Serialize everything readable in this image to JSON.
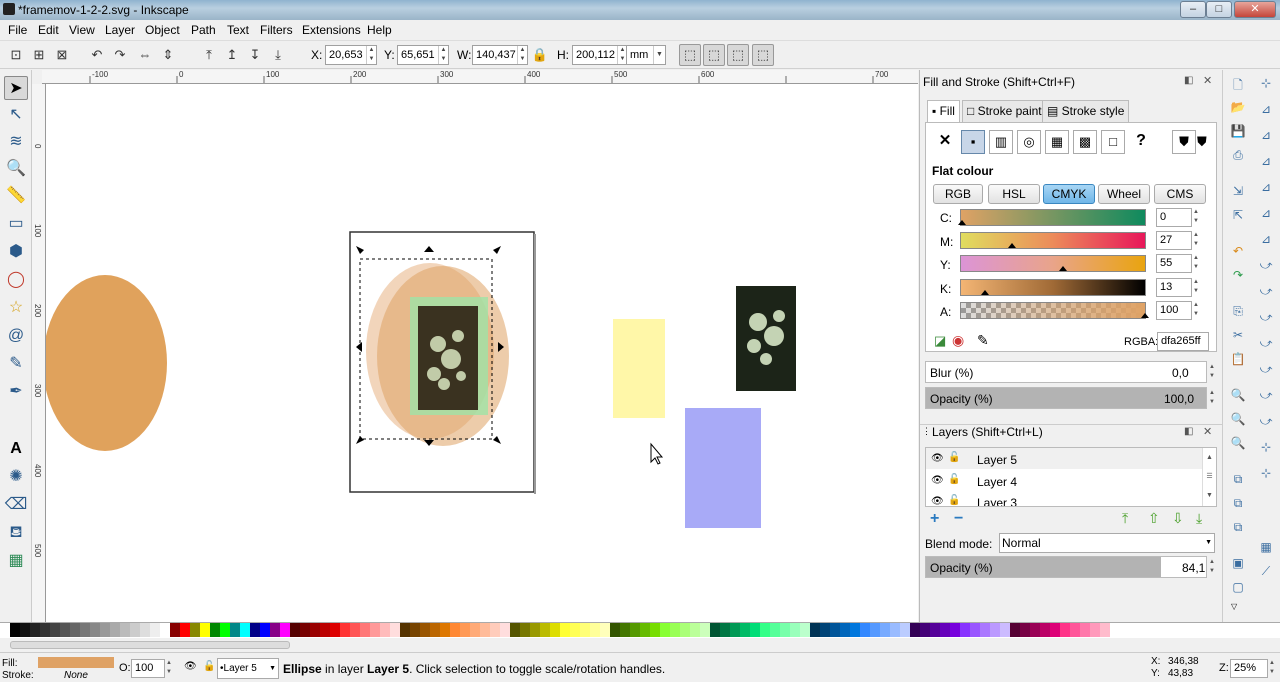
{
  "window": {
    "title": "*framemov-1-2-2.svg - Inkscape",
    "min": "–",
    "max": "□",
    "close": "✕"
  },
  "menu": [
    "File",
    "Edit",
    "View",
    "Layer",
    "Object",
    "Path",
    "Text",
    "Filters",
    "Extensions",
    "Help"
  ],
  "toolctl": {
    "x_label": "X:",
    "x_value": "20,653",
    "y_label": "Y:",
    "y_value": "65,651",
    "w_label": "W:",
    "w_value": "140,437",
    "h_label": "H:",
    "h_value": "200,112",
    "unit": "mm"
  },
  "hruler_ticks": [
    "-100",
    "0",
    "100",
    "200",
    "300",
    "400",
    "500",
    "600",
    "700"
  ],
  "vruler_ticks": [
    "0",
    "100",
    "200",
    "300",
    "400",
    "500",
    "600"
  ],
  "fillstroke": {
    "title": "Fill and Stroke (Shift+Ctrl+F)",
    "tabs": [
      "Fill",
      "Stroke paint",
      "Stroke style"
    ],
    "none_glyph": "✕",
    "unknown_glyph": "?",
    "flat_label": "Flat colour",
    "modes": [
      "RGB",
      "HSL",
      "CMYK",
      "Wheel",
      "CMS"
    ],
    "selected_mode": "CMYK",
    "channels": [
      {
        "label": "C:",
        "value": "0"
      },
      {
        "label": "M:",
        "value": "27"
      },
      {
        "label": "Y:",
        "value": "55"
      },
      {
        "label": "K:",
        "value": "13"
      },
      {
        "label": "A:",
        "value": "100"
      }
    ],
    "rgba_label": "RGBA:",
    "rgba_value": "dfa265ff",
    "blur_label": "Blur (%)",
    "blur_value": "0,0",
    "opacity_label": "Opacity (%)",
    "opacity_value": "100,0"
  },
  "layers": {
    "title": "Layers (Shift+Ctrl+L)",
    "items": [
      "Layer 5",
      "Layer 4",
      "Layer 3"
    ],
    "blend_label": "Blend mode:",
    "blend_value": "Normal",
    "opacity_label": "Opacity (%)",
    "opacity_value": "84,1",
    "opacity_fraction": 0.841
  },
  "status": {
    "fill_label": "Fill:",
    "stroke_label": "Stroke:",
    "stroke_value": "None",
    "o_label": "O:",
    "o_value": "100",
    "layer": "•Layer 5",
    "message_bold": "Ellipse",
    "message_mid": " in layer ",
    "message_layer": "Layer 5",
    "message_rest": ". Click selection to toggle scale/rotation handles.",
    "x_label": "X:",
    "x": "346,38",
    "y_label": "Y:",
    "y": "43,83",
    "z_label": "Z:",
    "zoom": "25%"
  },
  "colors": {
    "fill": "#dfa265",
    "ellipse": "#e0a25c",
    "yellow_rect": "#fff7a8",
    "blue_rect": "#a8aaf7",
    "accent": "#3a87c0"
  }
}
